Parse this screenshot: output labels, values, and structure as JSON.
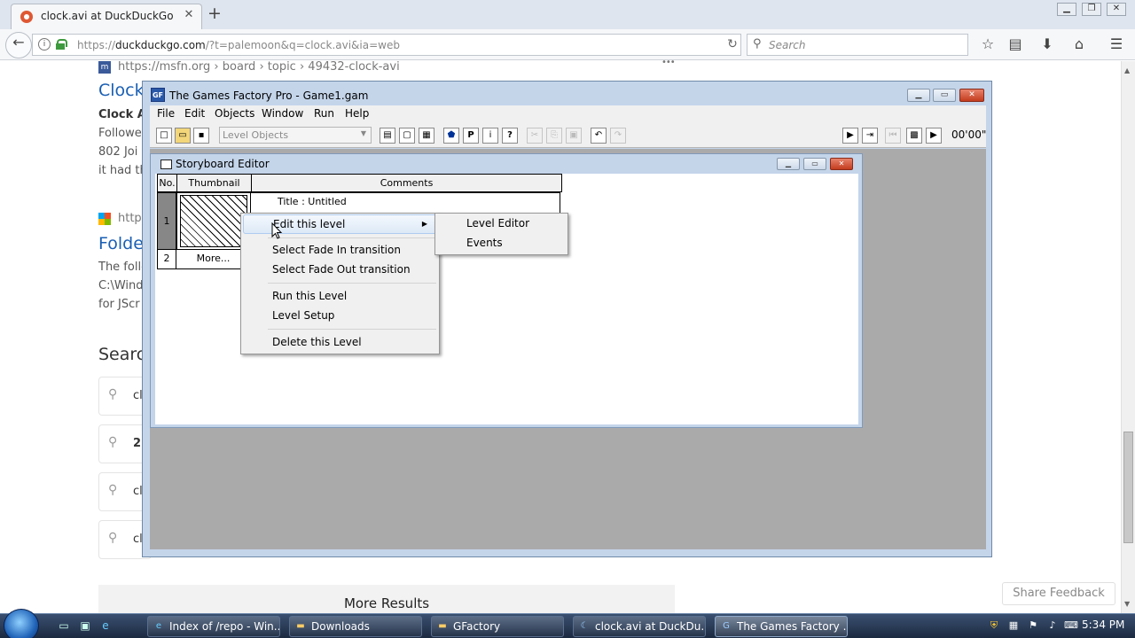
{
  "browser": {
    "tab_title": "clock.avi at DuckDuckGo",
    "url_prefix": "https://",
    "url_host": "duckduckgo.com",
    "url_rest": "/?t=palemoon&q=clock.avi&ia=web",
    "search_placeholder": "Search"
  },
  "page": {
    "result1_breadcrumb": "https://msfn.org › board › topic › 49432-clock-avi",
    "result1_title": "Clock",
    "result1_snippet": [
      "Clock A",
      "Followe",
      "802 Joi",
      "it had th"
    ],
    "result2_breadcrumb": "http",
    "result2_title": "Folde",
    "result2_snippet": [
      "The follo",
      "C:\\Windo",
      "for JScr"
    ],
    "searches_heading": "Searc",
    "related": [
      "cl",
      "2",
      "cl",
      "cl"
    ],
    "more_results": "More Results",
    "share_feedback": "Share Feedback",
    "more_dots": "•••"
  },
  "tgf": {
    "title": "The Games Factory Pro - Game1.gam",
    "menu": [
      "File",
      "Edit",
      "Objects",
      "Window",
      "Run",
      "Help"
    ],
    "combo_value": "Level Objects",
    "timer": "00'00\""
  },
  "storyboard": {
    "title": "Storyboard Editor",
    "columns": [
      "No.",
      "Thumbnail",
      "Comments"
    ],
    "row1_no": "1",
    "row1_comment": "Title : Untitled",
    "row2_no": "2",
    "row2_more": "More..."
  },
  "context_menu": {
    "items": [
      "Edit this level",
      "Select Fade In transition",
      "Select Fade Out transition",
      "Run this Level",
      "Level Setup",
      "Delete this Level"
    ],
    "submenu": [
      "Level Editor",
      "Events"
    ]
  },
  "taskbar": {
    "buttons": [
      "Index of /repo - Win...",
      "Downloads",
      "GFactory",
      "clock.avi at DuckDu...",
      "The Games Factory ..."
    ],
    "clock": "5:34 PM"
  },
  "colors": {
    "accent_blue": "#1a5fb4",
    "tgf_frame": "#c4d5ea",
    "workspace": "#abaaab"
  }
}
